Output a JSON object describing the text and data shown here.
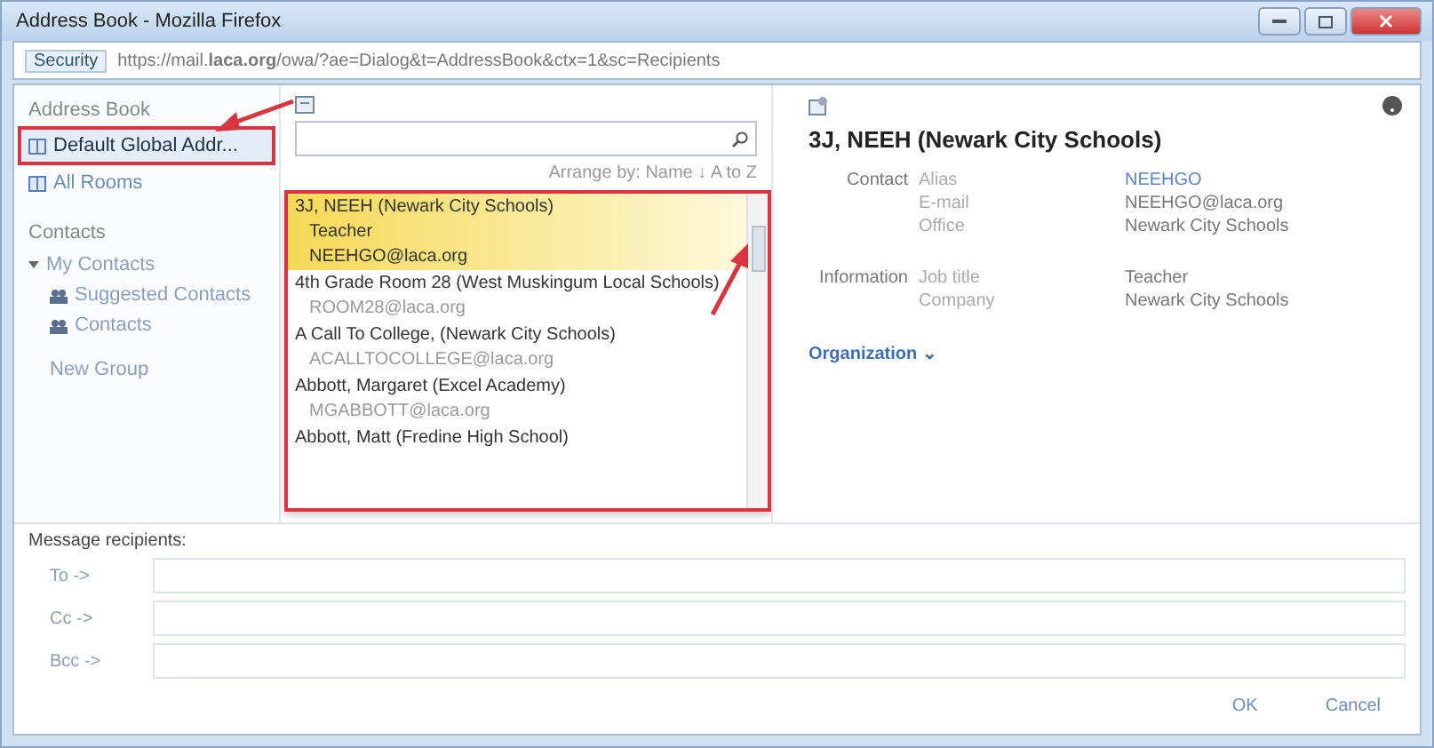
{
  "window": {
    "title": "Address Book - Mozilla Firefox"
  },
  "address_bar": {
    "security_label": "Security",
    "url": "https://mail.**laca.org**/owa/?ae=Dialog&t=AddressBook&ctx=1&sc=Recipients"
  },
  "address_books": {
    "heading": "Address Book",
    "items": [
      {
        "label": "Default Global Addr...",
        "selected": true,
        "highlighted": true
      },
      {
        "label": "All Rooms",
        "selected": false,
        "highlighted": false
      }
    ]
  },
  "contacts": {
    "heading": "Contacts",
    "items": [
      {
        "label": "My Contacts",
        "expanded": true,
        "children": [
          {
            "label": "Suggested Contacts"
          },
          {
            "label": "Contacts"
          }
        ]
      }
    ],
    "new_group": "New Group"
  },
  "arrange_by": "Arrange by: Name ↓  A to Z",
  "results": {
    "highlighted": true,
    "items": [
      {
        "name": "3J, NEEH (Newark City Schools)",
        "details": [
          "Teacher",
          "NEEHGO@laca.org"
        ],
        "selected": true
      },
      {
        "name": "4th Grade Room 28 (West Muskingum Local Schools)",
        "details": [
          "ROOM28@laca.org"
        ],
        "selected": false
      },
      {
        "name": "A Call To College, (Newark City Schools)",
        "details": [
          "ACALLTOCOLLEGE@laca.org"
        ],
        "selected": false
      },
      {
        "name": "Abbott, Margaret (Excel Academy)",
        "details": [
          "MGABBOTT@laca.org"
        ],
        "selected": false
      },
      {
        "name": "Abbott, Matt (Fredine High School)",
        "selected": false
      }
    ]
  },
  "detail": {
    "title": "3J, NEEH (Newark City Schools)",
    "sections": [
      {
        "heading": "Contact",
        "fields": [
          {
            "label": "Alias",
            "value": "NEEHGO",
            "kind": "link"
          },
          {
            "label": "E-mail",
            "value": "NEEHGO@laca.org",
            "kind": "text"
          },
          {
            "label": "Office",
            "value": "Newark City Schools",
            "kind": "text"
          }
        ]
      },
      {
        "heading": "Information",
        "fields": [
          {
            "label": "Job title",
            "value": "Teacher",
            "kind": "text"
          },
          {
            "label": "Company",
            "value": "Newark City Schools",
            "kind": "text"
          }
        ]
      }
    ],
    "organization": "Organization ⌄"
  },
  "recipients": {
    "heading": "Message recipients:",
    "fields": [
      {
        "label": "To ->"
      },
      {
        "label": "Cc ->"
      },
      {
        "label": "Bcc ->"
      }
    ]
  },
  "buttons": [
    {
      "label": "OK"
    },
    {
      "label": "Cancel"
    }
  ]
}
